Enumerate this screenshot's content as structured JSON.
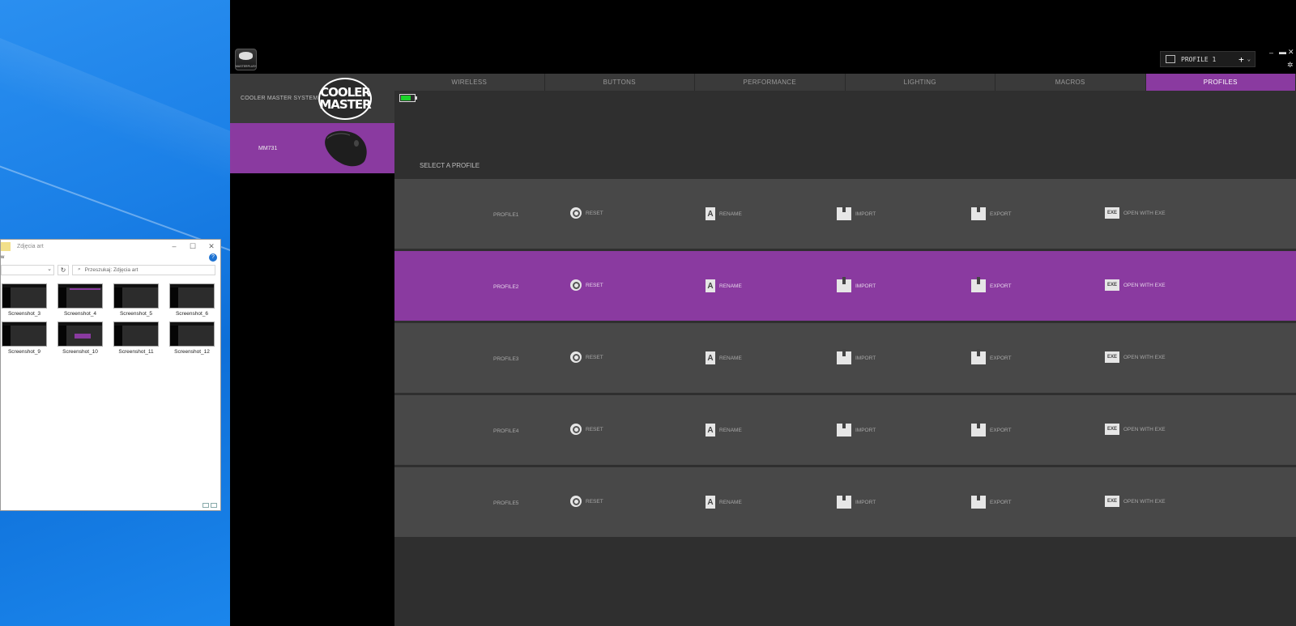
{
  "explorer": {
    "title": "Zdjęcia art",
    "ribbon_partial": "w",
    "search_placeholder": "Przeszukaj: Zdjęcia art",
    "files": [
      {
        "name": "Screenshot_3"
      },
      {
        "name": "Screenshot_4"
      },
      {
        "name": "Screenshot_5"
      },
      {
        "name": "Screenshot_6"
      },
      {
        "name": "Screenshot_9"
      },
      {
        "name": "Screenshot_10"
      },
      {
        "name": "Screenshot_11"
      },
      {
        "name": "Screenshot_12"
      }
    ]
  },
  "app": {
    "logo_text": "MASTERPLUS+",
    "current_profile": "PROFILE 1",
    "system_label": "COOLER MASTER SYSTEM",
    "brand_line1": "COOLER",
    "brand_line2": "MASTER",
    "device_label": "MM731",
    "tabs": [
      "WIRELESS",
      "BUTTONS",
      "PERFORMANCE",
      "LIGHTING",
      "MACROS",
      "PROFILES"
    ],
    "active_tab": "PROFILES",
    "select_label": "SELECT A PROFILE",
    "actions": {
      "reset": "RESET",
      "rename": "RENAME",
      "import": "IMPORT",
      "export": "EXPORT",
      "open_with_exe": "OPEN WITH EXE"
    },
    "profiles": [
      {
        "name": "PROFILE1",
        "active": false
      },
      {
        "name": "PROFILE2",
        "active": true
      },
      {
        "name": "PROFILE3",
        "active": false
      },
      {
        "name": "PROFILE4",
        "active": false
      },
      {
        "name": "PROFILE5",
        "active": false
      }
    ],
    "colors": {
      "accent": "#8a3aa0",
      "battery": "#1bd42a",
      "panel": "#484848"
    }
  }
}
